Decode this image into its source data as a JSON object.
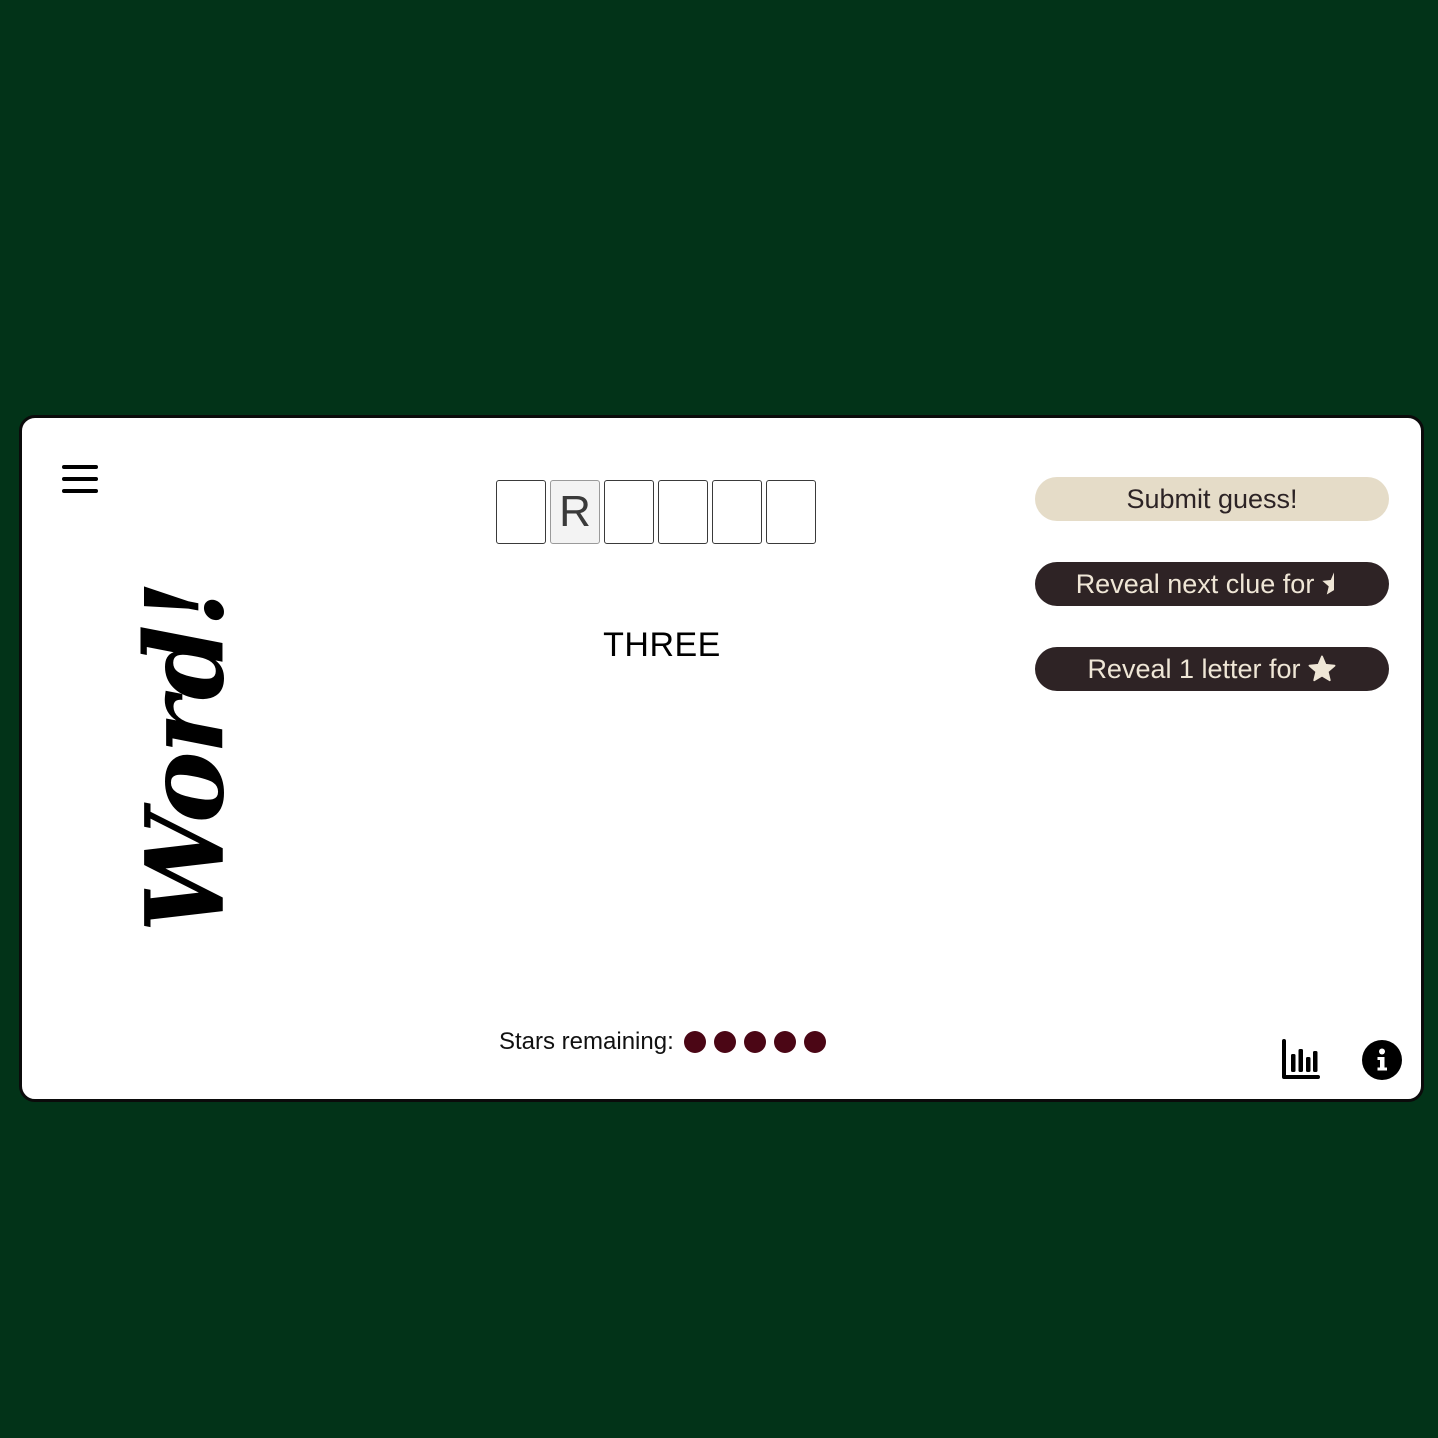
{
  "header": {
    "menu_icon": "hamburger-menu-icon",
    "logo_text": "Word!"
  },
  "puzzle": {
    "letters": [
      "",
      "R",
      "",
      "",
      "",
      ""
    ],
    "current_clue": "THREE"
  },
  "actions": {
    "submit_label": "Submit guess!",
    "reveal_clue_label": "Reveal next clue for",
    "reveal_clue_cost_icon": "half-star-icon",
    "reveal_letter_label": "Reveal 1 letter for",
    "reveal_letter_cost_icon": "star-icon"
  },
  "footer": {
    "stars_label": "Stars remaining:",
    "stars_remaining": 5,
    "stats_icon": "bar-chart-icon",
    "info_icon": "info-icon"
  },
  "colors": {
    "background": "#023318",
    "card": "#ffffff",
    "submit_button": "#e5dcc8",
    "dark_button": "#2e2325",
    "button_text_light": "#efe6d6",
    "star_dot": "#4b0615"
  }
}
